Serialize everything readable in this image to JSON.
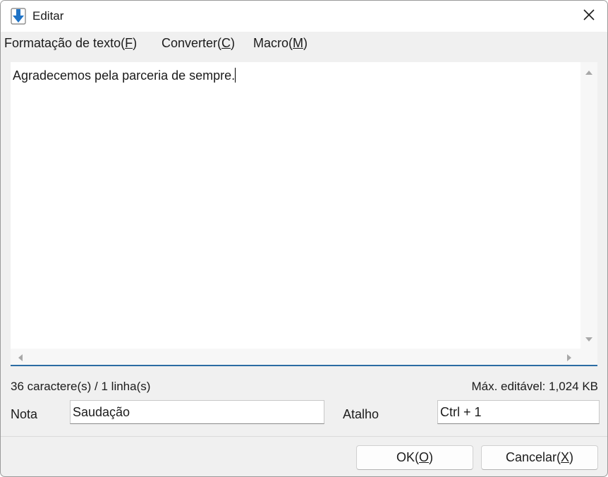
{
  "window": {
    "title": "Editar",
    "icon": "download-arrow-icon"
  },
  "menu": [
    {
      "label": "Formatação de texto(",
      "key": "F",
      "suffix": ")"
    },
    {
      "label": "Converter(",
      "key": "C",
      "suffix": ")"
    },
    {
      "label": "Macro(",
      "key": "M",
      "suffix": ")"
    }
  ],
  "editor": {
    "text": "Agradecemos pela parceria de sempre."
  },
  "status": {
    "counts": "36 caractere(s) / 1 linha(s)",
    "max_editable": "Máx. editável: 1,024 KB"
  },
  "form": {
    "note_label": "Nota",
    "note_value": "Saudação",
    "shortcut_label": "Atalho",
    "shortcut_value": "Ctrl + 1"
  },
  "buttons": {
    "ok": {
      "label": "OK(",
      "key": "O",
      "suffix": ")"
    },
    "cancel": {
      "label": "Cancelar(",
      "key": "X",
      "suffix": ")"
    }
  },
  "colors": {
    "accent": "#2b6ca3",
    "icon_blue": "#1f73c6"
  }
}
